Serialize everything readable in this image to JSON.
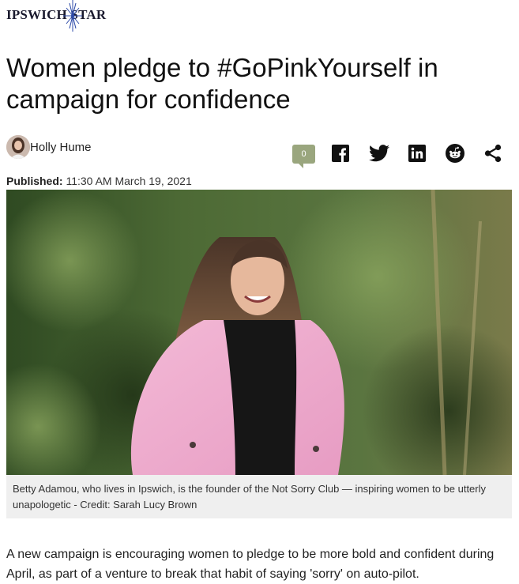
{
  "masthead": {
    "logo_text": "IPSWICH STAR",
    "logo_icon": "star-burst-icon",
    "logo_color": "#1a1a2e"
  },
  "article": {
    "headline": "Women pledge to #GoPinkYourself in campaign for confidence",
    "author": "Holly Hume",
    "published_label": "Published:",
    "published_time": "11:30 AM March 19, 2021",
    "photo_caption": "Betty Adamou, who lives in Ipswich, is the founder of the Not Sorry Club — inspiring women to be utterly unapologetic - Credit: Sarah Lucy Brown",
    "body_first_paragraph": "A new campaign is encouraging women to pledge to be more bold and confident during April, as part of a venture to break that habit of saying 'sorry' on auto-pilot."
  },
  "share_bar": {
    "comment_count": "0",
    "comment_color": "#9aa67e",
    "items": [
      "facebook-icon",
      "twitter-icon",
      "linkedin-icon",
      "reddit-icon",
      "share-icon"
    ]
  }
}
